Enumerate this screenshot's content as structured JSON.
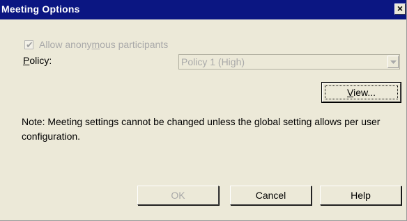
{
  "window": {
    "title": "Meeting Options",
    "close_glyph": "×"
  },
  "anonymous": {
    "label_before": "Allow anony",
    "label_mnemonic": "m",
    "label_after": "ous participants",
    "checked": true,
    "enabled": false
  },
  "policy": {
    "label_mnemonic": "P",
    "label_after": "olicy:",
    "selected_value": "Policy 1 (High)",
    "enabled": false
  },
  "view_button": {
    "label_mnemonic": "V",
    "label_after": "iew..."
  },
  "note": "Note: Meeting settings cannot be changed unless the global setting allows per user configuration.",
  "buttons": {
    "ok": "OK",
    "cancel": "Cancel",
    "help": "Help"
  },
  "icons": {
    "close": "close-icon",
    "check": "checkmark-icon",
    "dropdown": "chevron-down-icon"
  },
  "colors": {
    "titlebar": "#0b1682",
    "dialog_bg": "#ece9d8",
    "disabled_text": "#a9a9a9"
  }
}
